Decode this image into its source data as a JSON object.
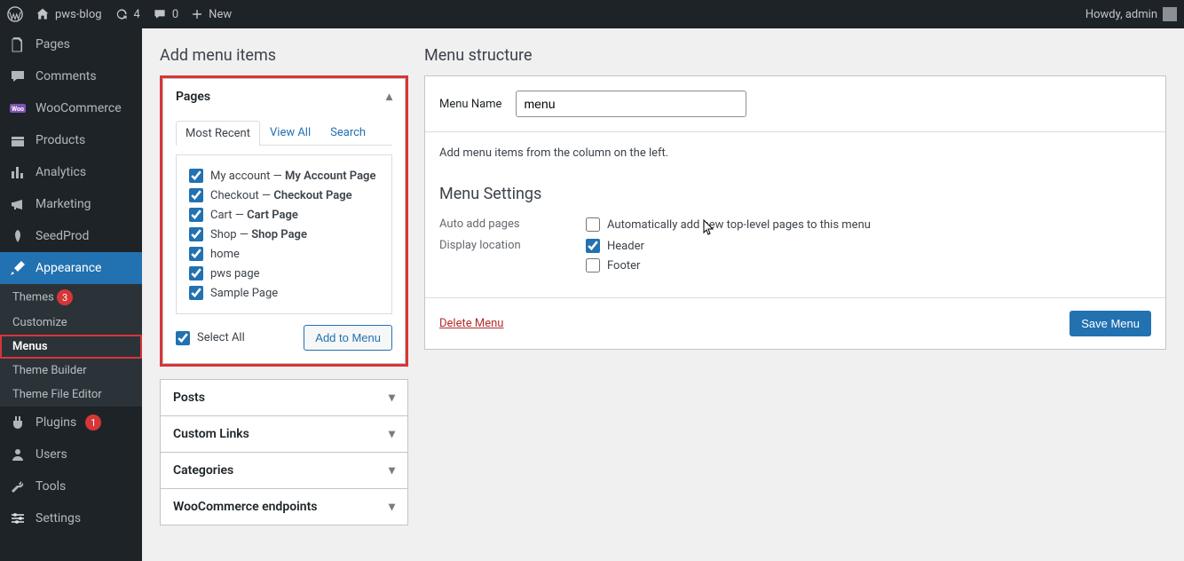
{
  "adminBar": {
    "siteTitle": "pws-blog",
    "updates": "4",
    "comments": "0",
    "new": "New",
    "howdy": "Howdy, admin"
  },
  "sidebar": {
    "items": [
      {
        "label": "Pages"
      },
      {
        "label": "Comments"
      },
      {
        "label": "WooCommerce"
      },
      {
        "label": "Products"
      },
      {
        "label": "Analytics"
      },
      {
        "label": "Marketing"
      },
      {
        "label": "SeedProd"
      },
      {
        "label": "Appearance"
      },
      {
        "label": "Plugins",
        "badge": "1"
      },
      {
        "label": "Users"
      },
      {
        "label": "Tools"
      },
      {
        "label": "Settings"
      }
    ],
    "submenu": [
      {
        "label": "Themes",
        "badge": "3"
      },
      {
        "label": "Customize"
      },
      {
        "label": "Menus"
      },
      {
        "label": "Theme Builder"
      },
      {
        "label": "Theme File Editor"
      }
    ]
  },
  "addMenu": {
    "title": "Add menu items",
    "accordions": {
      "pages": {
        "label": "Pages"
      },
      "posts": {
        "label": "Posts"
      },
      "customLinks": {
        "label": "Custom Links"
      },
      "categories": {
        "label": "Categories"
      },
      "woo": {
        "label": "WooCommerce endpoints"
      }
    },
    "tabs": {
      "recent": "Most Recent",
      "viewAll": "View All",
      "search": "Search"
    },
    "pageItems": [
      {
        "text": "My account",
        "suffix": "My Account Page"
      },
      {
        "text": "Checkout",
        "suffix": "Checkout Page"
      },
      {
        "text": "Cart",
        "suffix": "Cart Page"
      },
      {
        "text": "Shop",
        "suffix": "Shop Page"
      },
      {
        "text": "home"
      },
      {
        "text": "pws page"
      },
      {
        "text": "Sample Page"
      }
    ],
    "selectAll": "Select All",
    "addToMenu": "Add to Menu"
  },
  "structure": {
    "title": "Menu structure",
    "menuNameLabel": "Menu Name",
    "menuNameValue": "menu",
    "hint": "Add menu items from the column on the left.",
    "settingsTitle": "Menu Settings",
    "autoAddLabel": "Auto add pages",
    "autoAddOption": "Automatically add new top-level pages to this menu",
    "displayLabel": "Display location",
    "locHeader": "Header",
    "locFooter": "Footer",
    "deleteMenu": "Delete Menu",
    "saveMenu": "Save Menu"
  }
}
